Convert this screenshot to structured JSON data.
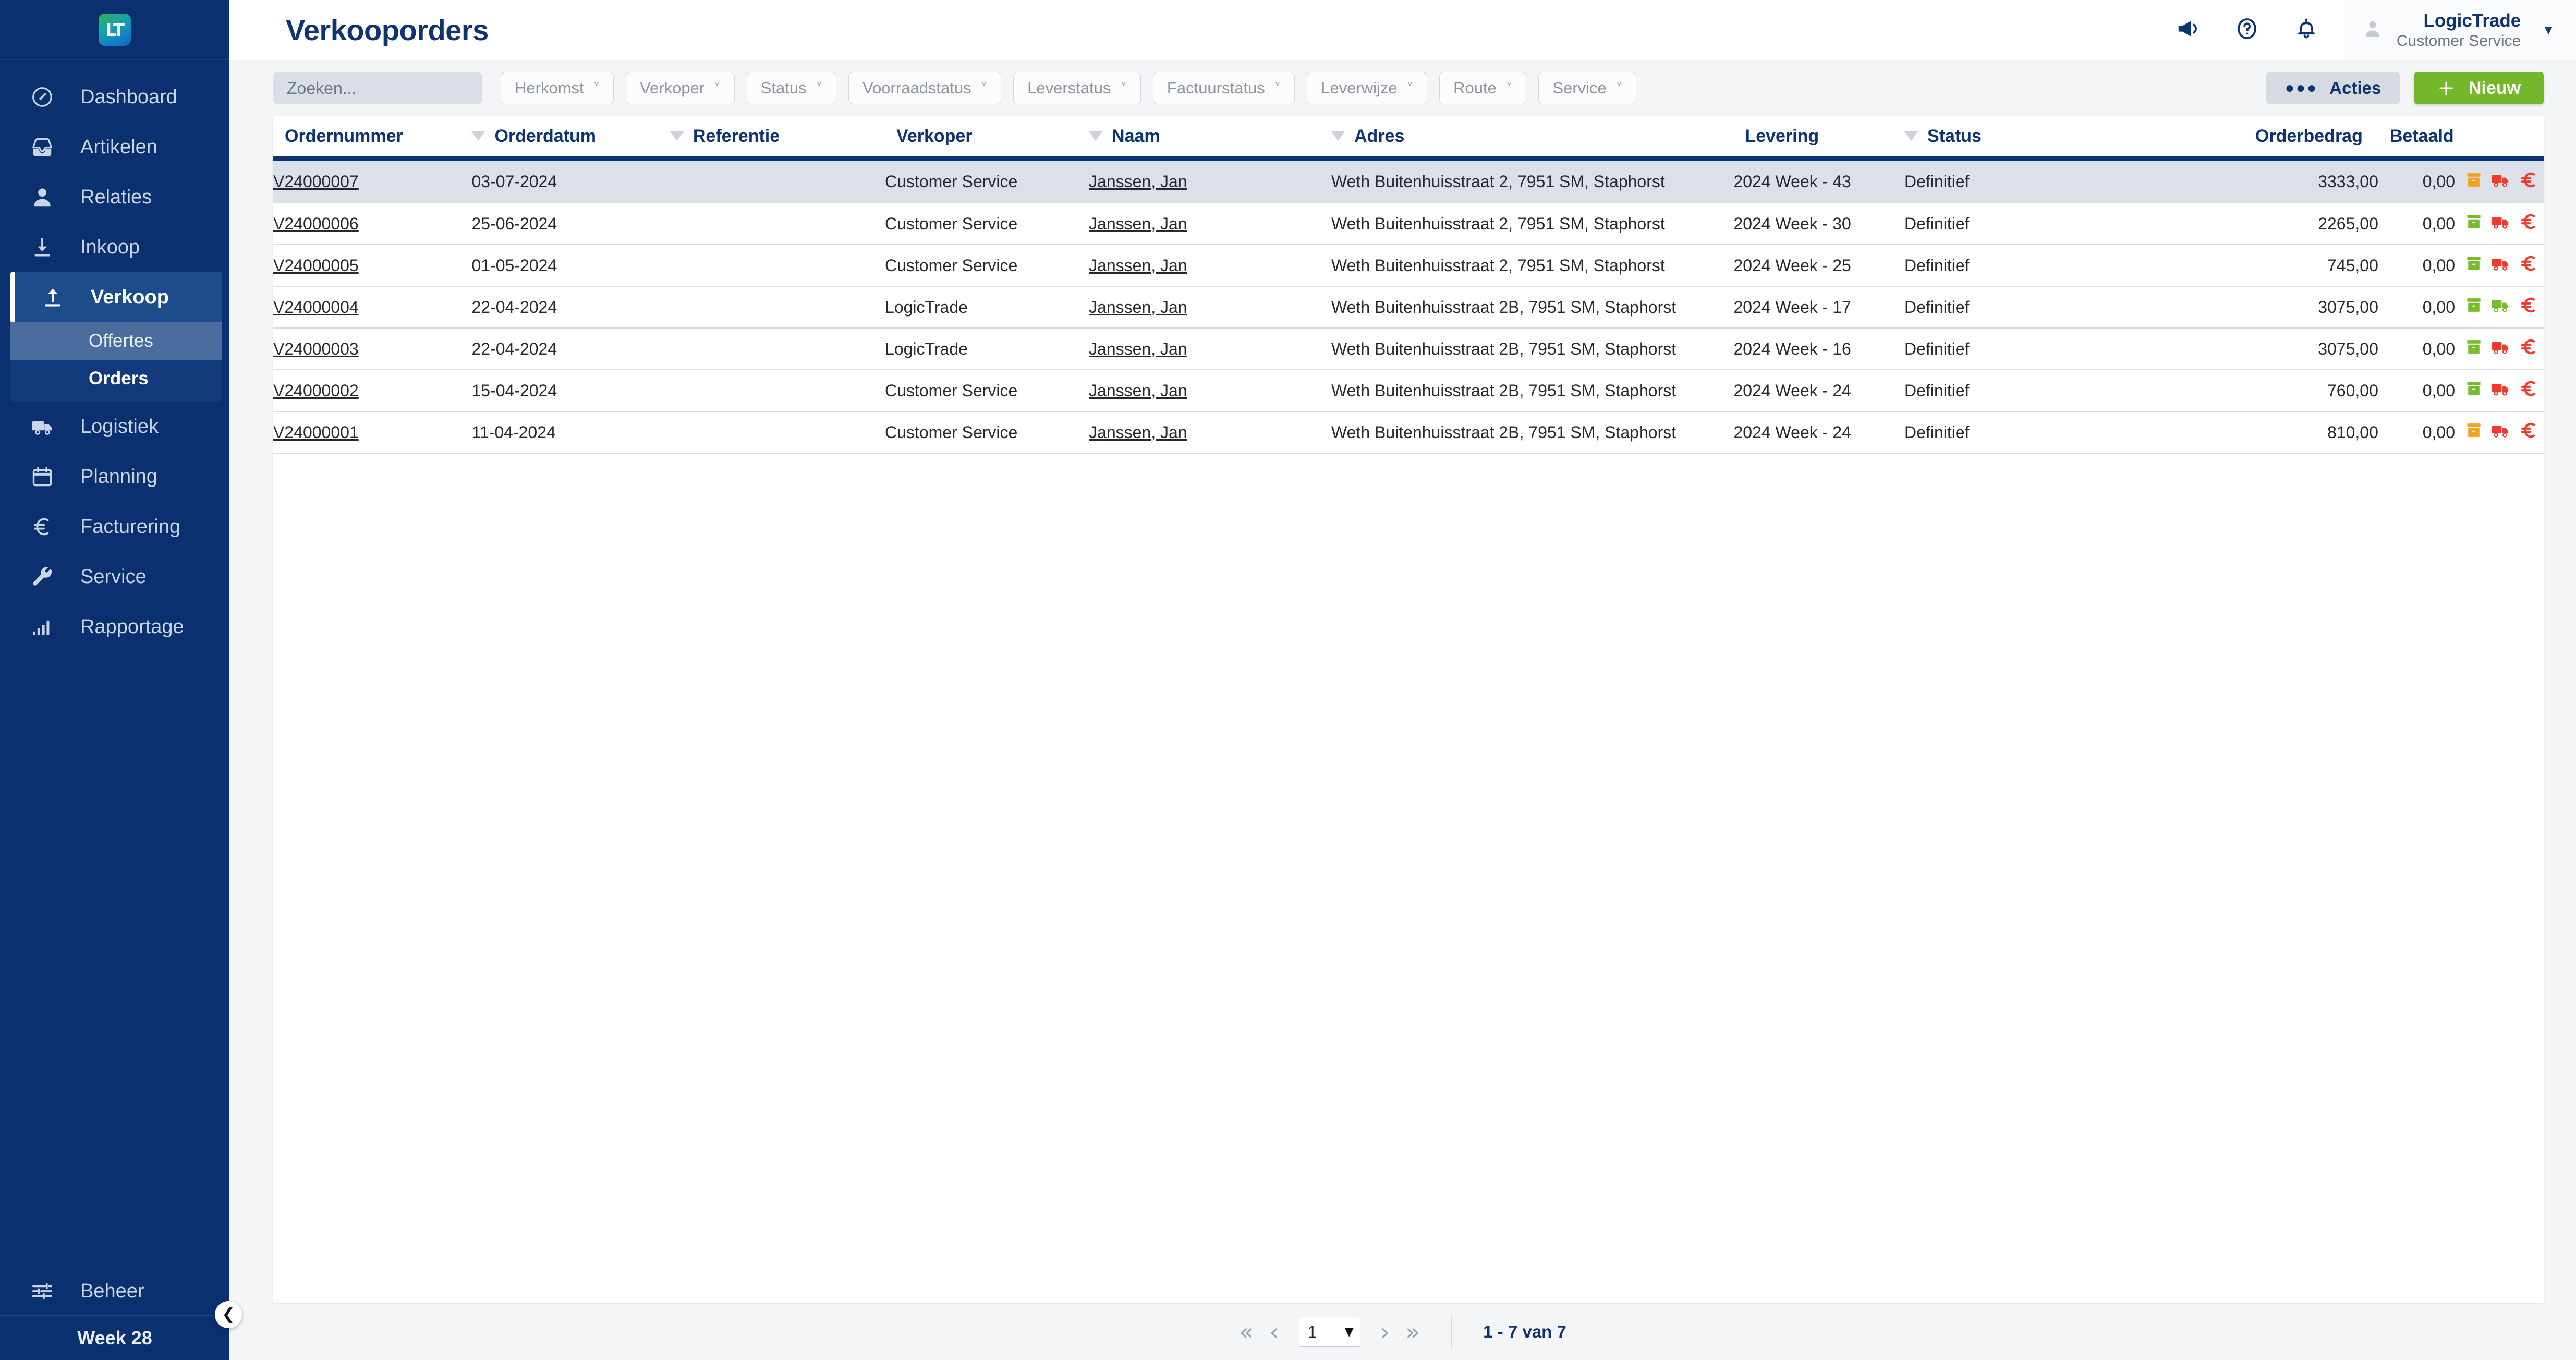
{
  "brand": {
    "logo_text": "LT",
    "accent_blue": "#0a3070",
    "accent_green": "#75b72a"
  },
  "sidebar": {
    "items": [
      {
        "label": "Dashboard",
        "icon": "dashboard-icon"
      },
      {
        "label": "Artikelen",
        "icon": "inbox-icon"
      },
      {
        "label": "Relaties",
        "icon": "user-icon"
      },
      {
        "label": "Inkoop",
        "icon": "download-arrow-icon"
      }
    ],
    "active_group": {
      "label": "Verkoop",
      "icon": "upload-arrow-icon"
    },
    "sub_items": [
      {
        "label": "Offertes"
      },
      {
        "label": "Orders"
      }
    ],
    "items_after": [
      {
        "label": "Logistiek",
        "icon": "truck-icon"
      },
      {
        "label": "Planning",
        "icon": "calendar-icon"
      },
      {
        "label": "Facturering",
        "icon": "euro-icon"
      },
      {
        "label": "Service",
        "icon": "wrench-icon"
      },
      {
        "label": "Rapportage",
        "icon": "bar-chart-icon"
      }
    ],
    "beheer": {
      "label": "Beheer",
      "icon": "sliders-icon"
    },
    "week_label": "Week 28",
    "collapse_icon": "chevron-left-icon"
  },
  "topbar": {
    "title": "Verkooporders",
    "icons": [
      "megaphone-icon",
      "help-circle-icon",
      "bell-icon"
    ],
    "user": {
      "name": "LogicTrade",
      "role": "Customer Service",
      "avatar": "avatar-icon",
      "caret": "chevron-down-icon"
    }
  },
  "toolbar": {
    "search_placeholder": "Zoeken...",
    "search_value": "",
    "search_icon": "search-icon",
    "filters": [
      {
        "label": "Herkomst"
      },
      {
        "label": "Verkoper"
      },
      {
        "label": "Status"
      },
      {
        "label": "Voorraadstatus"
      },
      {
        "label": "Leverstatus"
      },
      {
        "label": "Factuurstatus"
      },
      {
        "label": "Leverwijze"
      },
      {
        "label": "Route"
      },
      {
        "label": "Service"
      }
    ],
    "acties_label": "Acties",
    "nieuw_label": "Nieuw"
  },
  "table": {
    "columns": [
      {
        "label": "Ordernummer",
        "sortable": false
      },
      {
        "label": "Orderdatum",
        "sortable": true
      },
      {
        "label": "Referentie",
        "sortable": true
      },
      {
        "label": "Verkoper",
        "sortable": false
      },
      {
        "label": "Naam",
        "sortable": true
      },
      {
        "label": "Adres",
        "sortable": true
      },
      {
        "label": "Levering",
        "sortable": false
      },
      {
        "label": "Status",
        "sortable": true
      },
      {
        "label": "Orderbedrag",
        "sortable": false
      },
      {
        "label": "Betaald",
        "sortable": false
      }
    ],
    "rows": [
      {
        "ordernummer": "V24000007",
        "orderdatum": "03-07-2024",
        "referentie": "",
        "verkoper": "Customer Service",
        "naam": "Janssen, Jan",
        "adres": "Weth Buitenhuisstraat 2, 7951 SM, Staphorst",
        "levering": "2024 Week - 43",
        "status": "Definitief",
        "orderbedrag": "3333,00",
        "betaald": "0,00",
        "icons": {
          "stock": "#f5a11d",
          "delivery": "#ef3b2d",
          "invoice": "#ef3b2d"
        },
        "selected": true
      },
      {
        "ordernummer": "V24000006",
        "orderdatum": "25-06-2024",
        "referentie": "",
        "verkoper": "Customer Service",
        "naam": "Janssen, Jan",
        "adres": "Weth Buitenhuisstraat 2, 7951 SM, Staphorst",
        "levering": "2024 Week - 30",
        "status": "Definitief",
        "orderbedrag": "2265,00",
        "betaald": "0,00",
        "icons": {
          "stock": "#77bc2b",
          "delivery": "#ef3b2d",
          "invoice": "#ef3b2d"
        },
        "selected": false
      },
      {
        "ordernummer": "V24000005",
        "orderdatum": "01-05-2024",
        "referentie": "",
        "verkoper": "Customer Service",
        "naam": "Janssen, Jan",
        "adres": "Weth Buitenhuisstraat 2, 7951 SM, Staphorst",
        "levering": "2024 Week - 25",
        "status": "Definitief",
        "orderbedrag": "745,00",
        "betaald": "0,00",
        "icons": {
          "stock": "#77bc2b",
          "delivery": "#ef3b2d",
          "invoice": "#ef3b2d"
        },
        "selected": false
      },
      {
        "ordernummer": "V24000004",
        "orderdatum": "22-04-2024",
        "referentie": "",
        "verkoper": "LogicTrade",
        "naam": "Janssen, Jan",
        "adres": "Weth Buitenhuisstraat 2B, 7951 SM, Staphorst",
        "levering": "2024 Week - 17",
        "status": "Definitief",
        "orderbedrag": "3075,00",
        "betaald": "0,00",
        "icons": {
          "stock": "#77bc2b",
          "delivery": "#77bc2b",
          "invoice": "#ef3b2d"
        },
        "selected": false
      },
      {
        "ordernummer": "V24000003",
        "orderdatum": "22-04-2024",
        "referentie": "",
        "verkoper": "LogicTrade",
        "naam": "Janssen, Jan",
        "adres": "Weth Buitenhuisstraat 2B, 7951 SM, Staphorst",
        "levering": "2024 Week - 16",
        "status": "Definitief",
        "orderbedrag": "3075,00",
        "betaald": "0,00",
        "icons": {
          "stock": "#77bc2b",
          "delivery": "#ef3b2d",
          "invoice": "#ef3b2d"
        },
        "selected": false
      },
      {
        "ordernummer": "V24000002",
        "orderdatum": "15-04-2024",
        "referentie": "",
        "verkoper": "Customer Service",
        "naam": "Janssen, Jan",
        "adres": "Weth Buitenhuisstraat 2B, 7951 SM, Staphorst",
        "levering": "2024 Week - 24",
        "status": "Definitief",
        "orderbedrag": "760,00",
        "betaald": "0,00",
        "icons": {
          "stock": "#77bc2b",
          "delivery": "#ef3b2d",
          "invoice": "#ef3b2d"
        },
        "selected": false
      },
      {
        "ordernummer": "V24000001",
        "orderdatum": "11-04-2024",
        "referentie": "",
        "verkoper": "Customer Service",
        "naam": "Janssen, Jan",
        "adres": "Weth Buitenhuisstraat 2B, 7951 SM, Staphorst",
        "levering": "2024 Week - 24",
        "status": "Definitief",
        "orderbedrag": "810,00",
        "betaald": "0,00",
        "icons": {
          "stock": "#f5a11d",
          "delivery": "#ef3b2d",
          "invoice": "#ef3b2d"
        },
        "selected": false
      }
    ]
  },
  "pagination": {
    "first_icon": "double-chevron-left-icon",
    "prev_icon": "chevron-left-icon",
    "page_value": "1",
    "next_icon": "chevron-right-icon",
    "last_icon": "double-chevron-right-icon",
    "count_label": "1 - 7 van 7"
  }
}
